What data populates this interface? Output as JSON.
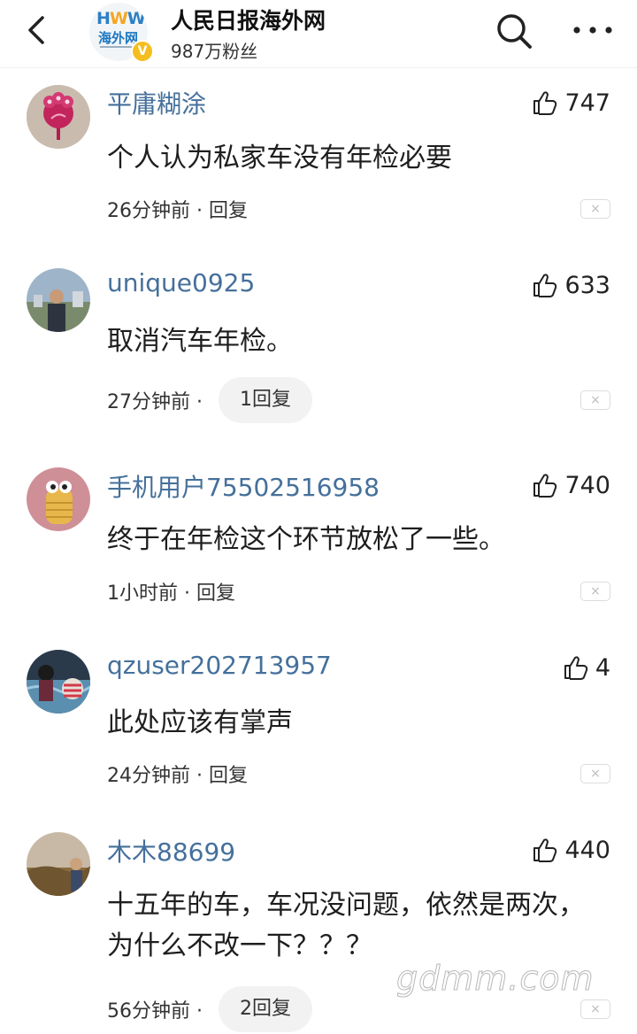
{
  "header": {
    "back_icon": "chevron-left-icon",
    "logo_text": "HWW",
    "logo_subtext": "海外网",
    "account_name": "人民日报海外网",
    "followers": "987万粉丝",
    "verified_badge": "V",
    "search_icon": "search-icon",
    "more_icon": "more-dots-icon"
  },
  "comments": [
    {
      "username": "平庸糊涂",
      "likes": "747",
      "text": "个人认为私家车没有年检必要",
      "time": "26分钟前 · 回复",
      "reply_pill": ""
    },
    {
      "username": "unique0925",
      "likes": "633",
      "text": "取消汽车年检。",
      "time": "27分钟前 ·",
      "reply_pill": "1回复"
    },
    {
      "username": "手机用户75502516958",
      "likes": "740",
      "text": "终于在年检这个环节放松了一些。",
      "time": "1小时前 · 回复",
      "reply_pill": ""
    },
    {
      "username": "qzuser202713957",
      "likes": "4",
      "text": "此处应该有掌声",
      "time": "24分钟前 · 回复",
      "reply_pill": ""
    },
    {
      "username": "木木88699",
      "likes": "440",
      "text": "十五年的车，车况没问题，依然是两次，为什么不改一下？？？",
      "time": "56分钟前 ·",
      "reply_pill": "2回复"
    }
  ],
  "close_glyph": "×",
  "watermark": "gdmm.com",
  "colors": {
    "username": "#45709b",
    "verified": "#f5bd1f",
    "pill_bg": "#f2f2f2"
  }
}
